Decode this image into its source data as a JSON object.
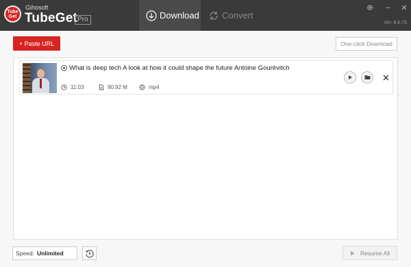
{
  "app": {
    "brand_small": "Gihosoft",
    "brand_name": "TubeGet",
    "edition": "Pro",
    "logo_text": "Tube Get",
    "version": "Ver: 8.6.76"
  },
  "tabs": [
    {
      "label": "Download",
      "icon": "download-circle-icon",
      "active": true
    },
    {
      "label": "Convert",
      "icon": "convert-arrows-icon",
      "active": false
    }
  ],
  "window_controls": {
    "settings_icon": "gear-icon",
    "minimize": "–",
    "close": "✕"
  },
  "toolbar": {
    "paste_url_label": "+ Paste URL",
    "one_click_label": "One-click Download"
  },
  "downloads": [
    {
      "title": "What is deep tech A look at how it could shape the future  Antoine Gourévitch",
      "duration": "11:03",
      "size": "90.92 M",
      "format": "mp4"
    }
  ],
  "footer": {
    "speed_label": "Speed:",
    "speed_value": "Unlimited",
    "history_icon": "history-clock-icon",
    "resume_label": "Resume All"
  },
  "colors": {
    "accent": "#d82323",
    "titlebar": "#3a3a3a",
    "active_tab": "#4a4a4a"
  }
}
